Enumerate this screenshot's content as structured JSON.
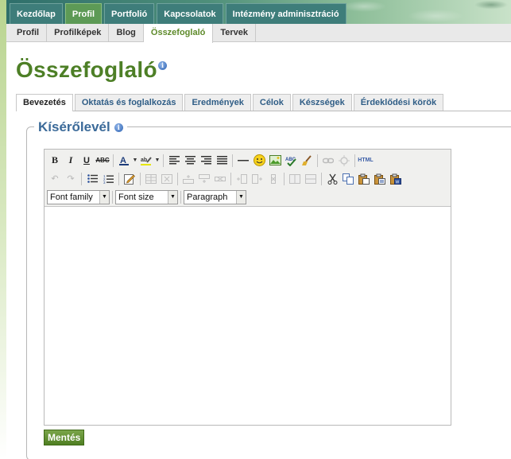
{
  "topnav": {
    "items": [
      "Kezdőlap",
      "Profil",
      "Portfolió",
      "Kapcsolatok",
      "Intézmény adminisztráció"
    ],
    "active_index": 1
  },
  "subnav": {
    "items": [
      "Profil",
      "Profilképek",
      "Blog",
      "Összefoglaló",
      "Tervek"
    ],
    "active_index": 3
  },
  "page": {
    "title": "Összefoglaló"
  },
  "content_tabs": {
    "items": [
      "Bevezetés",
      "Oktatás és foglalkozás",
      "Eredmények",
      "Célok",
      "Készségek",
      "Érdeklődési körök"
    ],
    "active_index": 0
  },
  "section": {
    "legend": "Kísérőlevél"
  },
  "editor": {
    "font_family": "Font family",
    "font_size": "Font size",
    "format": "Paragraph",
    "html_label": "HTML",
    "strike_label": "ABC",
    "content": ""
  },
  "save_button": "Mentés",
  "colors": {
    "brand_green": "#4d7f26",
    "nav_teal": "#3e7d7a",
    "legend_blue": "#3b6a99"
  }
}
